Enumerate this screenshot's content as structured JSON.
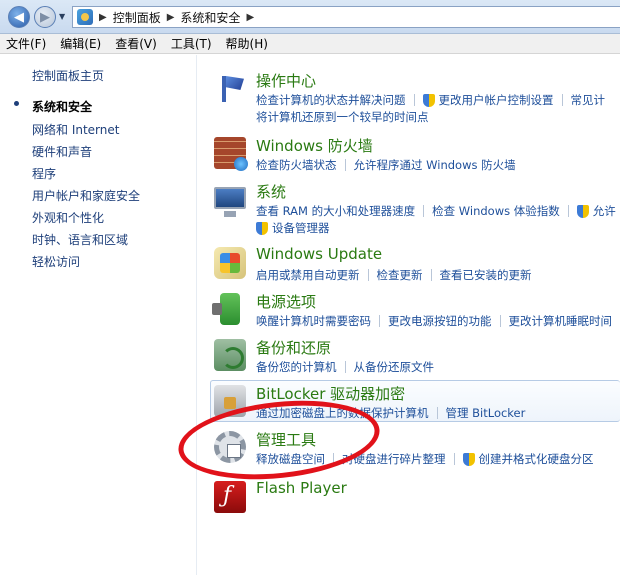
{
  "breadcrumb": [
    "控制面板",
    "系统和安全"
  ],
  "menu": [
    "文件(F)",
    "编辑(E)",
    "查看(V)",
    "工具(T)",
    "帮助(H)"
  ],
  "sidebar": {
    "home": "控制面板主页",
    "items": [
      "系统和安全",
      "网络和 Internet",
      "硬件和声音",
      "程序",
      "用户帐户和家庭安全",
      "外观和个性化",
      "时钟、语言和区域",
      "轻松访问"
    ]
  },
  "categories": [
    {
      "title": "操作中心",
      "icon": "flag-icon",
      "row1": [
        "检查计算机的状态并解决问题",
        "更改用户帐户控制设置",
        "常见计"
      ],
      "row2": [
        "将计算机还原到一个较早的时间点"
      ]
    },
    {
      "title": "Windows 防火墙",
      "icon": "firewall-icon",
      "row1": [
        "检查防火墙状态",
        "允许程序通过 Windows 防火墙"
      ]
    },
    {
      "title": "系统",
      "icon": "computer-icon",
      "row1": [
        "查看 RAM 的大小和处理器速度",
        "检查 Windows 体验指数",
        "允许"
      ],
      "row2": [
        "设备管理器"
      ]
    },
    {
      "title": "Windows Update",
      "icon": "windows-update-icon",
      "row1": [
        "启用或禁用自动更新",
        "检查更新",
        "查看已安装的更新"
      ]
    },
    {
      "title": "电源选项",
      "icon": "battery-icon",
      "row1": [
        "唤醒计算机时需要密码",
        "更改电源按钮的功能",
        "更改计算机睡眠时间"
      ]
    },
    {
      "title": "备份和还原",
      "icon": "backup-icon",
      "row1": [
        "备份您的计算机",
        "从备份还原文件"
      ]
    },
    {
      "title": "BitLocker 驱动器加密",
      "icon": "bitlocker-icon",
      "row1": [
        "通过加密磁盘上的数据保护计算机",
        "管理 BitLocker"
      ]
    },
    {
      "title": "管理工具",
      "icon": "admin-tools-icon",
      "row1": [
        "释放磁盘空间",
        "对硬盘进行碎片整理",
        "创建并格式化硬盘分区"
      ]
    },
    {
      "title": "Flash Player",
      "icon": "flash-icon"
    }
  ],
  "colors": {
    "link": "#1e4f9a",
    "title": "#2a7a12",
    "annotation": "#e1121a"
  }
}
